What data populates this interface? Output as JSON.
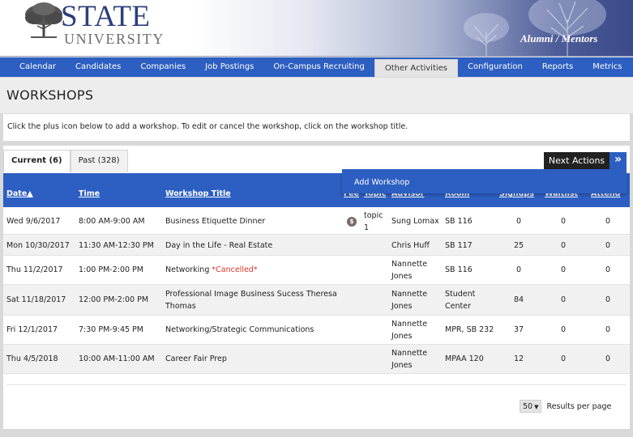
{
  "header": {
    "logo_state": "STATE",
    "logo_university": "UNIVERSITY",
    "tagline": "Alumni / Mentors"
  },
  "nav": {
    "items": [
      {
        "label": "Calendar"
      },
      {
        "label": "Candidates"
      },
      {
        "label": "Companies"
      },
      {
        "label": "Job Postings"
      },
      {
        "label": "On-Campus Recruiting"
      },
      {
        "label": "Other Activities",
        "active": true
      },
      {
        "label": "Configuration"
      },
      {
        "label": "Reports"
      },
      {
        "label": "Metrics"
      }
    ]
  },
  "page": {
    "title": "WORKSHOPS",
    "instructions": "Click the plus icon below to add a workshop.  To edit or cancel the workshop, click on the workshop title."
  },
  "tabs": [
    {
      "label": "Current (6)",
      "active": true
    },
    {
      "label": "Past (328)",
      "active": false
    }
  ],
  "next_actions": {
    "label": "Next Actions",
    "toggle": "»",
    "menu": [
      {
        "label": "Add Workshop"
      }
    ]
  },
  "table": {
    "columns": {
      "date": "Date▲",
      "time": "Time",
      "title": "Workshop Title",
      "fee": "Fee",
      "topic": "Topic",
      "advisor": "Advisor",
      "room": "Room",
      "signups": "Signups",
      "waitlist": "Waitlist",
      "attend": "Attend"
    },
    "rows": [
      {
        "date": "Wed 9/6/2017",
        "time": "8:00 AM-9:00 AM",
        "title": "Business Etiquette Dinner",
        "title_status": "",
        "has_fee": true,
        "fee_icon": "$",
        "topic": "topic 1",
        "advisor": "Sung Lomax",
        "room": "SB 116",
        "signups": "0",
        "waitlist": "0",
        "attend": "0"
      },
      {
        "date": "Mon 10/30/2017",
        "time": "11:30 AM-12:30 PM",
        "title": "Day in the Life - Real Estate",
        "title_status": "",
        "has_fee": false,
        "fee_icon": "",
        "topic": "",
        "advisor": "Chris Huff",
        "room": "SB 117",
        "signups": "25",
        "waitlist": "0",
        "attend": "0"
      },
      {
        "date": "Thu 11/2/2017",
        "time": "1:00 PM-2:00 PM",
        "title": "Networking",
        "title_status": "*Cancelled*",
        "has_fee": false,
        "fee_icon": "",
        "topic": "",
        "advisor": "Nannette Jones",
        "room": "SB 116",
        "signups": "0",
        "waitlist": "0",
        "attend": "0"
      },
      {
        "date": "Sat 11/18/2017",
        "time": "12:00 PM-2:00 PM",
        "title": "Professional Image Business Sucess Theresa Thomas",
        "title_status": "",
        "has_fee": false,
        "fee_icon": "",
        "topic": "",
        "advisor": "Nannette Jones",
        "room": "Student Center",
        "signups": "84",
        "waitlist": "0",
        "attend": "0"
      },
      {
        "date": "Fri 12/1/2017",
        "time": "7:30 PM-9:45 PM",
        "title": "Networking/Strategic Communications",
        "title_status": "",
        "has_fee": false,
        "fee_icon": "",
        "topic": "",
        "advisor": "Nannette Jones",
        "room": "MPR, SB 232",
        "signups": "37",
        "waitlist": "0",
        "attend": "0"
      },
      {
        "date": "Thu 4/5/2018",
        "time": "10:00 AM-11:00 AM",
        "title": "Career Fair Prep",
        "title_status": "",
        "has_fee": false,
        "fee_icon": "",
        "topic": "",
        "advisor": "Nannette Jones",
        "room": "MPAA 120",
        "signups": "12",
        "waitlist": "0",
        "attend": "0"
      }
    ]
  },
  "pagination": {
    "per_page_value": "50",
    "per_page_label": "Results per page"
  },
  "colors": {
    "primary_blue": "#2d5fc2",
    "brand_navy": "#2c3f7a",
    "cancelled_red": "#e0342c",
    "dark_button": "#222222"
  }
}
